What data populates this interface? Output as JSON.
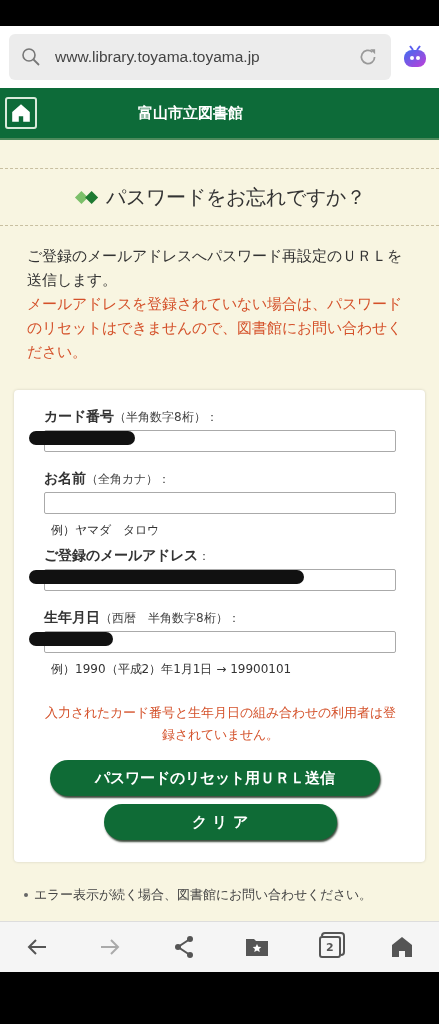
{
  "browser": {
    "url": "www.library.toyama.toyama.jp",
    "tab_count": "2",
    "back_disabled": false,
    "forward_disabled": true
  },
  "header": {
    "title": "富山市立図書館"
  },
  "page_title": "パスワードをお忘れですか？",
  "intro": [
    {
      "text": "ご登録のメールアドレスへパスワード再設定のＵＲＬを送信します。",
      "kind": "normal"
    },
    {
      "text": "メールアドレスを登録されていない場合は、パスワードのリセットはできませんので、図書館にお問い合わせください。",
      "kind": "warning"
    }
  ],
  "form": {
    "fields": [
      {
        "label": "カード番号",
        "hint": "（半角数字8桁）：",
        "redacted": true
      },
      {
        "label": "お名前",
        "hint": "（全角カナ）：",
        "redacted": false,
        "note": "例）ヤマダ　タロウ"
      },
      {
        "label": "ご登録のメールアドレス",
        "hint": "：",
        "redacted": true
      },
      {
        "label": "生年月日",
        "hint": "（西暦　半角数字8桁）：",
        "redacted": true,
        "note": "例）1990（平成2）年1月1日 → 19900101"
      }
    ],
    "error": "入力されたカード番号と生年月日の組み合わせの利用者は登録されていません。",
    "buttons": [
      {
        "label": "パスワードのリセット用ＵＲＬ送信",
        "kind": "wide"
      },
      {
        "label": "ク リ ア",
        "kind": "narrow"
      }
    ]
  },
  "footnote": "エラー表示が続く場合、図書館にお問い合わせください。"
}
